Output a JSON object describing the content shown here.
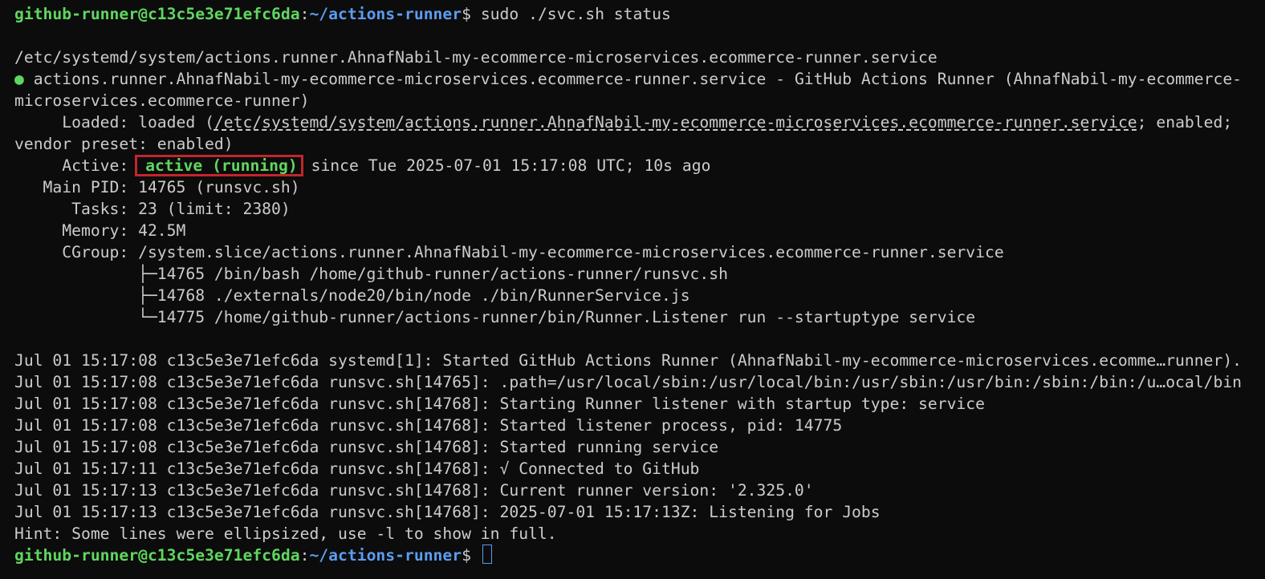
{
  "prompt": {
    "user_host": "github-runner@c13c5e3e71efc6da",
    "colon": ":",
    "path": "~/actions-runner",
    "dollar": "$ "
  },
  "command": "sudo ./svc.sh status",
  "unit_file_path": "/etc/systemd/system/actions.runner.AhnafNabil-my-ecommerce-microservices.ecommerce-runner.service",
  "service": {
    "dot": "●",
    "title_line1": " actions.runner.AhnafNabil-my-ecommerce-microservices.ecommerce-runner.service - GitHub Actions Runner (AhnafNabil-my-ecommerce-",
    "title_line2": "microservices.ecommerce-runner)",
    "loaded_label": "     Loaded: ",
    "loaded_prefix": "loaded (",
    "loaded_path": "/etc/systemd/system/actions.runner.AhnafNabil-my-ecommerce-microservices.ecommerce-runner.service",
    "loaded_suffix": "; enabled;",
    "loaded_line2": "vendor preset: enabled)",
    "active_label": "     Active: ",
    "active_state": "active (running)",
    "active_since": " since Tue 2025-07-01 15:17:08 UTC; 10s ago",
    "main_pid": "   Main PID: 14765 (runsvc.sh)",
    "tasks": "      Tasks: 23 (limit: 2380)",
    "memory": "     Memory: 42.5M",
    "cgroup": "     CGroup: /system.slice/actions.runner.AhnafNabil-my-ecommerce-microservices.ecommerce-runner.service",
    "cgroup_procs": [
      "             ├─14765 /bin/bash /home/github-runner/actions-runner/runsvc.sh",
      "             ├─14768 ./externals/node20/bin/node ./bin/RunnerService.js",
      "             └─14775 /home/github-runner/actions-runner/bin/Runner.Listener run --startuptype service"
    ]
  },
  "logs": [
    "Jul 01 15:17:08 c13c5e3e71efc6da systemd[1]: Started GitHub Actions Runner (AhnafNabil-my-ecommerce-microservices.ecomme…runner).",
    "Jul 01 15:17:08 c13c5e3e71efc6da runsvc.sh[14765]: .path=/usr/local/sbin:/usr/local/bin:/usr/sbin:/usr/bin:/sbin:/bin:/u…ocal/bin",
    "Jul 01 15:17:08 c13c5e3e71efc6da runsvc.sh[14768]: Starting Runner listener with startup type: service",
    "Jul 01 15:17:08 c13c5e3e71efc6da runsvc.sh[14768]: Started listener process, pid: 14775",
    "Jul 01 15:17:08 c13c5e3e71efc6da runsvc.sh[14768]: Started running service",
    "Jul 01 15:17:11 c13c5e3e71efc6da runsvc.sh[14768]: √ Connected to GitHub",
    "Jul 01 15:17:13 c13c5e3e71efc6da runsvc.sh[14768]: Current runner version: '2.325.0'",
    "Jul 01 15:17:13 c13c5e3e71efc6da runsvc.sh[14768]: 2025-07-01 15:17:13Z: Listening for Jobs"
  ],
  "hint": "Hint: Some lines were ellipsized, use -l to show in full.",
  "colors": {
    "background": "#0c0c0c",
    "foreground": "#cccccc",
    "prompt_green": "#5fd75f",
    "prompt_blue": "#5b9cf0",
    "highlight_red": "#c0262c"
  }
}
